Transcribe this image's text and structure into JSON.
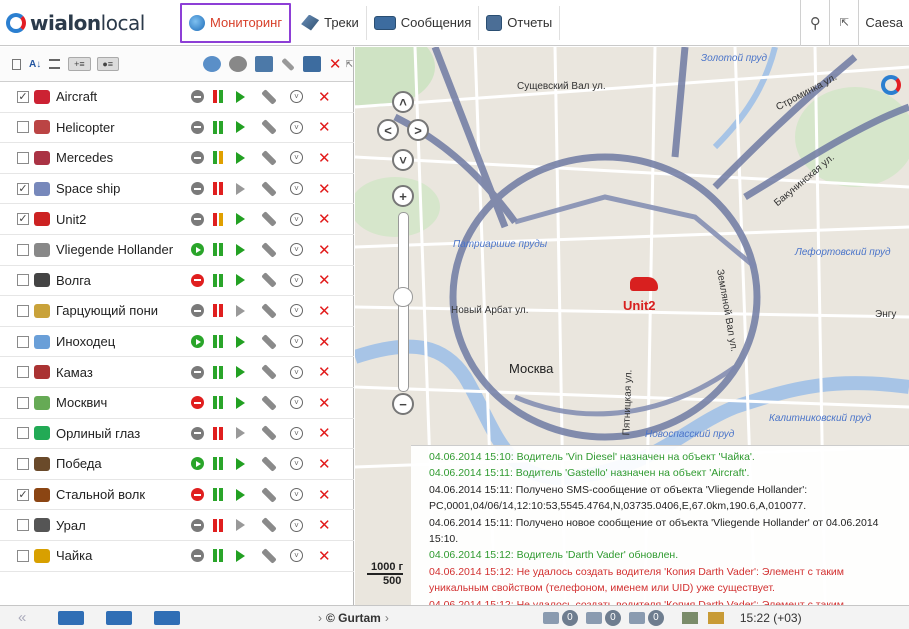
{
  "header": {
    "logo_brand": "wialon",
    "logo_suffix": "local",
    "tabs": [
      {
        "label": "Мониторинг",
        "icon": "globe-icon",
        "active": true
      },
      {
        "label": "Треки",
        "icon": "track-icon",
        "active": false
      },
      {
        "label": "Сообщения",
        "icon": "messages-icon",
        "active": false
      },
      {
        "label": "Отчеты",
        "icon": "report-icon",
        "active": false
      }
    ],
    "user": "Caesa"
  },
  "units": [
    {
      "name": "Aircraft",
      "checked": true,
      "state": "grey",
      "signal": [
        "#e01f1f",
        "#2aa52a"
      ],
      "move": true
    },
    {
      "name": "Helicopter",
      "checked": false,
      "state": "grey",
      "signal": [
        "#2aa52a",
        "#2aa52a"
      ],
      "move": true
    },
    {
      "name": "Mercedes",
      "checked": false,
      "state": "grey",
      "signal": [
        "#2aa52a",
        "#e0a000"
      ],
      "move": true
    },
    {
      "name": "Space ship",
      "checked": true,
      "state": "grey",
      "signal": [
        "#e01f1f",
        "#e01f1f"
      ],
      "move": false
    },
    {
      "name": "Unit2",
      "checked": true,
      "state": "grey",
      "signal": [
        "#e01f1f",
        "#e0a000"
      ],
      "move": true
    },
    {
      "name": "Vliegende Hollander",
      "checked": false,
      "state": "green",
      "signal": [
        "#2aa52a",
        "#2aa52a"
      ],
      "move": true
    },
    {
      "name": "Волга",
      "checked": false,
      "state": "red",
      "signal": [
        "#2aa52a",
        "#2aa52a"
      ],
      "move": true
    },
    {
      "name": "Гарцующий пони",
      "checked": false,
      "state": "grey",
      "signal": [
        "#e01f1f",
        "#e01f1f"
      ],
      "move": false
    },
    {
      "name": "Иноходец",
      "checked": false,
      "state": "green",
      "signal": [
        "#2aa52a",
        "#2aa52a"
      ],
      "move": true
    },
    {
      "name": "Камаз",
      "checked": false,
      "state": "grey",
      "signal": [
        "#2aa52a",
        "#2aa52a"
      ],
      "move": true
    },
    {
      "name": "Москвич",
      "checked": false,
      "state": "red",
      "signal": [
        "#2aa52a",
        "#2aa52a"
      ],
      "move": true
    },
    {
      "name": "Орлиный глаз",
      "checked": false,
      "state": "grey",
      "signal": [
        "#e01f1f",
        "#e01f1f"
      ],
      "move": false
    },
    {
      "name": "Победа",
      "checked": false,
      "state": "green",
      "signal": [
        "#2aa52a",
        "#2aa52a"
      ],
      "move": true
    },
    {
      "name": "Стальной волк",
      "checked": true,
      "state": "red",
      "signal": [
        "#2aa52a",
        "#2aa52a"
      ],
      "move": true
    },
    {
      "name": "Урал",
      "checked": false,
      "state": "grey",
      "signal": [
        "#e01f1f",
        "#e01f1f"
      ],
      "move": false
    },
    {
      "name": "Чайка",
      "checked": false,
      "state": "grey",
      "signal": [
        "#2aa52a",
        "#2aa52a"
      ],
      "move": true
    }
  ],
  "map": {
    "labels": {
      "center": "Москва",
      "unit": "Unit2",
      "pond1": "Золотой пруд",
      "pond2": "Патриаршие пруды",
      "pond3": "Лефортовский пруд",
      "pond4": "Новоспасский пруд",
      "pond5": "Калитниковский пруд",
      "street1": "Сущевский Вал ул.",
      "street2": "Новый Арбат ул.",
      "street3": "Пятницкая ул.",
      "street4": "Земляной Вал ул.",
      "street5": "Бакунинская ул.",
      "street6": "Строминка ул.",
      "street7": "Энгу"
    },
    "scale_top": "1000 г",
    "scale_bottom": "500"
  },
  "notifications": [
    {
      "text": "04.06.2014 15:10: Водитель 'Vin Diesel' назначен на объект 'Чайка'.",
      "color": "green"
    },
    {
      "text": "04.06.2014 15:11: Водитель 'Gastello' назначен на объект 'Aircraft'.",
      "color": "green"
    },
    {
      "text": "04.06.2014 15:11: Получено SMS-сообщение от объекта 'Vliegende Hollander': PC,0001,04/06/14,12:10:53,5545.4764,N,03735.0406,E,67.0km,190.6,A,010077.",
      "color": "black"
    },
    {
      "text": "04.06.2014 15:11: Получено новое сообщение от объекта 'Vliegende Hollander' от 04.06.2014 15:10.",
      "color": "black"
    },
    {
      "text": "04.06.2014 15:12: Водитель 'Darth Vader' обновлен.",
      "color": "green"
    },
    {
      "text": "04.06.2014 15:12: Не удалось создать водителя 'Копия Darth Vader': Элемент с таким уникальным свойством (телефоном, именем или UID) уже существует.",
      "color": "red"
    },
    {
      "text": "04.06.2014 15:12: Не удалось создать водителя 'Копия Darth Vader': Элемент с таким",
      "color": "red"
    }
  ],
  "footer": {
    "brand": "© Gurtam",
    "counters": [
      "0",
      "0",
      "0"
    ],
    "time": "15:22 (+03)"
  }
}
